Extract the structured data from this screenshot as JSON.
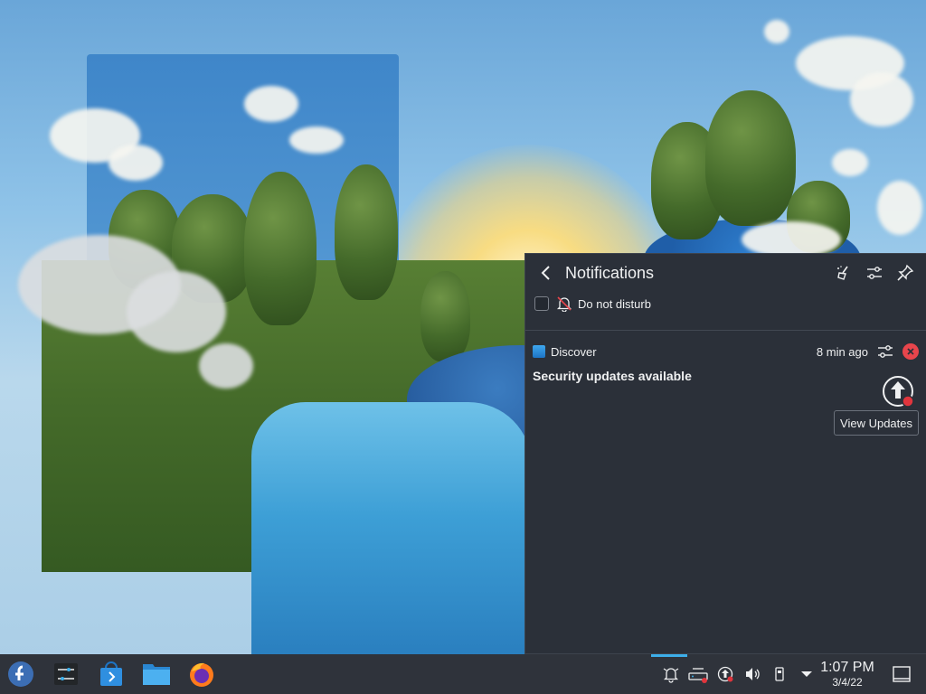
{
  "notifications": {
    "title": "Notifications",
    "dnd_label": "Do not disturb",
    "dnd_checked": false,
    "items": [
      {
        "app": "Discover",
        "time": "8 min ago",
        "summary": "Security updates available",
        "action_label": "View Updates"
      }
    ]
  },
  "taskbar": {
    "launchers": [
      "fedora-launcher-icon",
      "system-settings-icon",
      "discover-icon",
      "file-manager-icon",
      "firefox-icon"
    ],
    "tray_icons": [
      "notifications-bell-icon",
      "network-icon",
      "updates-icon",
      "volume-icon",
      "usb-device-icon",
      "expand-tray-icon"
    ],
    "clock_time": "1:07 PM",
    "clock_date": "3/4/22"
  },
  "colors": {
    "accent": "#3daee9",
    "panel_bg": "#2b3039",
    "taskbar_bg": "#2f333b",
    "close_red": "#e8454c",
    "badge_red": "#e0353d"
  }
}
